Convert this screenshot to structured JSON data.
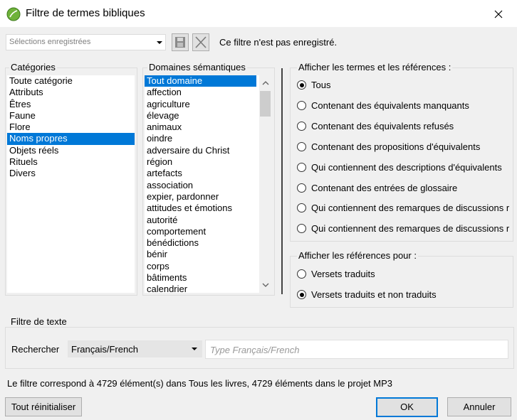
{
  "window": {
    "title": "Filtre de termes bibliques"
  },
  "saved": {
    "placeholder": "Sélections enregistrées",
    "status": "Ce filtre n'est pas enregistré."
  },
  "categories": {
    "label": "Catégories",
    "items": [
      "Toute catégorie",
      "Attributs",
      "Êtres",
      "Faune",
      "Flore",
      "Noms propres",
      "Objets réels",
      "Rituels",
      "Divers"
    ],
    "selected_index": 5
  },
  "domains": {
    "label": "Domaines sémantiques",
    "items": [
      "Tout domaine",
      "affection",
      "agriculture",
      "élevage",
      "animaux",
      "oindre",
      "adversaire du Christ",
      "région",
      "artefacts",
      "association",
      "expier, pardonner",
      "attitudes et émotions",
      "autorité",
      "comportement",
      "bénédictions",
      "bénir",
      "corps",
      "bâtiments",
      "calendrier"
    ],
    "selected_index": 0
  },
  "show_terms": {
    "label": "Afficher les termes et les références :",
    "options": [
      "Tous",
      "Contenant des équivalents manquants",
      "Contenant des équivalents refusés",
      "Contenant des propositions d'équivalents",
      "Qui contiennent des descriptions d'équivalents",
      "Contenant des entrées de glossaire",
      "Qui contiennent des remarques de discussions r",
      "Qui contiennent des remarques de discussions r"
    ],
    "checked_index": 0
  },
  "show_refs": {
    "label": "Afficher les références pour :",
    "options": [
      "Versets traduits",
      "Versets traduits et non traduits"
    ],
    "checked_index": 1
  },
  "text_filter": {
    "label": "Filtre de texte",
    "search_label": "Rechercher",
    "language": "Français/French",
    "input_placeholder": "Type Français/French"
  },
  "footer": {
    "status": "Le filtre correspond à 4729 élément(s) dans Tous les livres, 4729 éléments dans le projet MP3",
    "reset": "Tout réinitialiser",
    "ok": "OK",
    "cancel": "Annuler"
  },
  "colors": {
    "selection": "#0078d7",
    "icon_green": "#5aa02c"
  }
}
